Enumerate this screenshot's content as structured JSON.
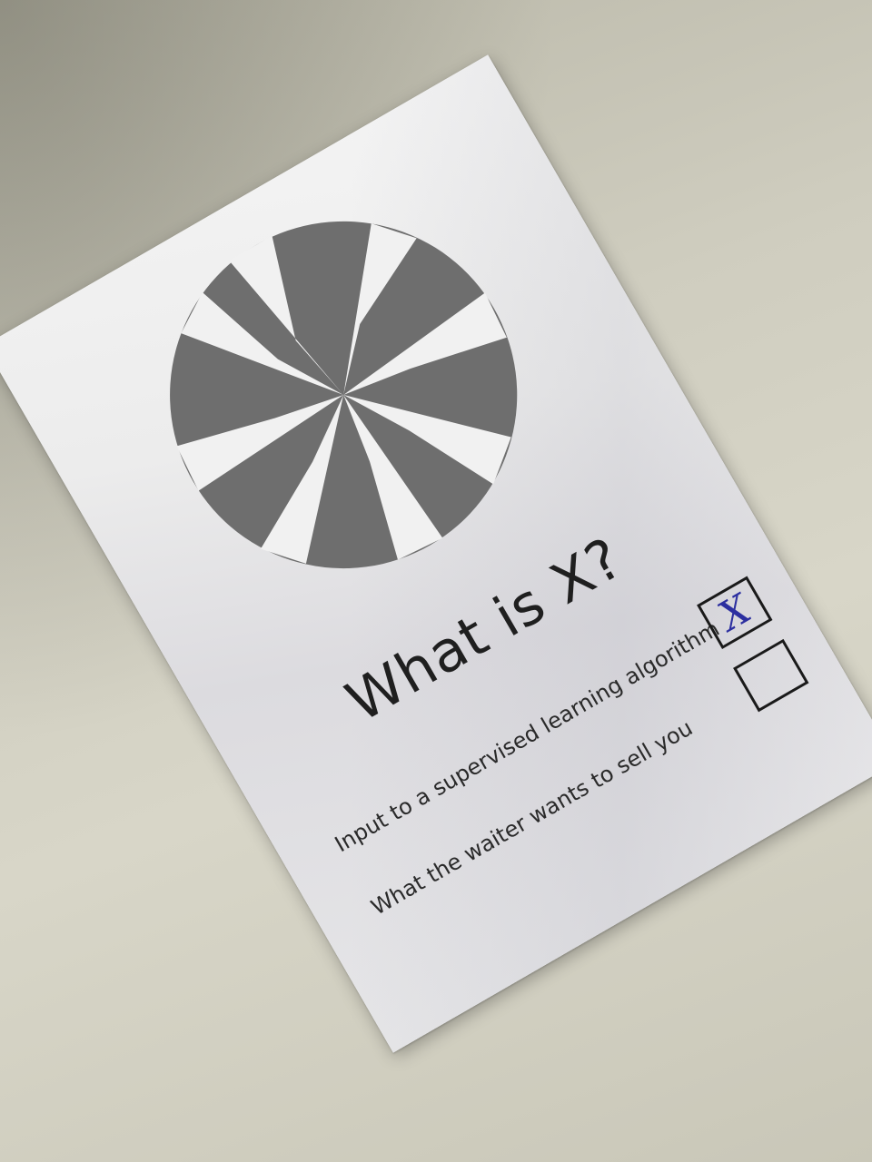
{
  "scene": {
    "description_free": true
  },
  "sheet": {
    "question": "What is X?",
    "options": [
      {
        "label": "Input to a supervised learning algorithm",
        "checked": true,
        "mark": "X"
      },
      {
        "label": "What the waiter wants to sell you",
        "checked": false,
        "mark": ""
      }
    ]
  },
  "colors": {
    "emblem": "#6b6b6b",
    "ink": "#1f1f1f",
    "pen": "#2c2fa0"
  },
  "icons": {
    "emblem": "pinwheel-emblem-icon"
  }
}
